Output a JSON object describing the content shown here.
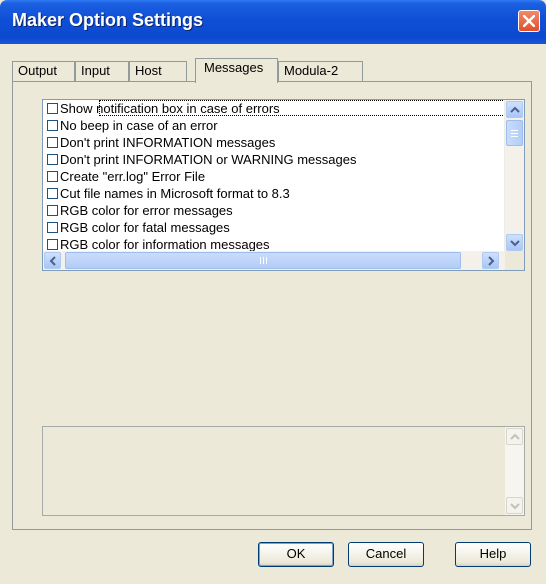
{
  "window": {
    "title": "Maker Option Settings"
  },
  "tabs": [
    {
      "label": "Output"
    },
    {
      "label": "Input"
    },
    {
      "label": "Host"
    },
    {
      "label": "Messages",
      "active": true
    },
    {
      "label": "Modula-2"
    }
  ],
  "messages_list": {
    "items": [
      {
        "label": "Show notification box in case of errors",
        "checked": false
      },
      {
        "label": "No beep in case of an error",
        "checked": false
      },
      {
        "label": "Don't print INFORMATION messages",
        "checked": false
      },
      {
        "label": "Don't print INFORMATION or WARNING messages",
        "checked": false
      },
      {
        "label": "Create \"err.log\" Error File",
        "checked": false
      },
      {
        "label": "Cut file names in Microsoft format to 8.3",
        "checked": false
      },
      {
        "label": "RGB color for error messages",
        "checked": false
      },
      {
        "label": "RGB color for fatal messages",
        "checked": false
      },
      {
        "label": "RGB color for information messages",
        "checked": false
      }
    ]
  },
  "buttons": {
    "ok": "OK",
    "cancel": "Cancel",
    "help": "Help"
  },
  "icons": {
    "close": "close-icon",
    "scroll_up": "arrow-up-icon",
    "scroll_down": "arrow-down-icon",
    "scroll_left": "arrow-left-icon",
    "scroll_right": "arrow-right-icon"
  },
  "colors": {
    "titlebar": "#0b49d0",
    "close": "#e0502a",
    "face": "#ece9d8"
  }
}
